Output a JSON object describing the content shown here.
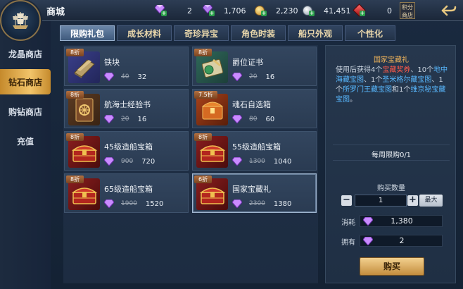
{
  "header": {
    "title": "商城",
    "jifen_label": "积分商店",
    "resources": [
      {
        "icon": "purple-gem-plus-icon",
        "value": "2"
      },
      {
        "icon": "purple-gem-stack-icon",
        "value": "1,706"
      },
      {
        "icon": "gold-coin-icon",
        "value": "2,230"
      },
      {
        "icon": "silver-coin-icon",
        "value": "41,451"
      },
      {
        "icon": "red-gem-icon",
        "value": "0"
      }
    ]
  },
  "sidebar": {
    "items": [
      {
        "label": "龙晶商店"
      },
      {
        "label": "钻石商店"
      },
      {
        "label": "购钻商店"
      },
      {
        "label": "充值"
      }
    ]
  },
  "tabs": [
    {
      "label": "限购礼包"
    },
    {
      "label": "成长材料"
    },
    {
      "label": "奇珍异宝"
    },
    {
      "label": "角色时装"
    },
    {
      "label": "船只外观"
    },
    {
      "label": "个性化"
    }
  ],
  "items": [
    {
      "badge": "8折",
      "name": "铁块",
      "old_price": "40",
      "price": "32",
      "icon": "iron-bar-icon"
    },
    {
      "badge": "8折",
      "name": "爵位证书",
      "old_price": "20",
      "price": "16",
      "icon": "certificate-icon"
    },
    {
      "badge": "8折",
      "name": "航海士经验书",
      "old_price": "20",
      "price": "16",
      "icon": "book-icon"
    },
    {
      "badge": "7.5折",
      "name": "魂石自选箱",
      "old_price": "80",
      "price": "60",
      "icon": "soulstone-box-icon"
    },
    {
      "badge": "8折",
      "name": "45级造船宝箱",
      "old_price": "900",
      "price": "720",
      "icon": "treasure-chest-icon"
    },
    {
      "badge": "8折",
      "name": "55级造船宝箱",
      "old_price": "1300",
      "price": "1040",
      "icon": "treasure-chest-icon"
    },
    {
      "badge": "8折",
      "name": "65级造船宝箱",
      "old_price": "1900",
      "price": "1520",
      "icon": "treasure-chest-icon"
    },
    {
      "badge": "6折",
      "name": "国家宝藏礼",
      "old_price": "2300",
      "price": "1380",
      "icon": "treasure-chest-icon"
    }
  ],
  "detail": {
    "title": "国家宝藏礼",
    "desc": {
      "p1": "使用后获得4个",
      "h1": "宝藏奖券",
      "p2": "、10个",
      "h2": "地中海藏宝图",
      "p3": "、1个",
      "h3": "圣米格尔藏宝图",
      "p4": "、1个",
      "h4": "所罗门王藏宝图",
      "p5": "和1个",
      "h5": "维京秘宝藏宝图",
      "p6": "。"
    },
    "weekly_limit": "每周限购0/1",
    "qty_label": "购买数量",
    "qty_value": "1",
    "minus": "−",
    "plus": "+",
    "max_label": "最大",
    "cost_label": "消耗",
    "cost_value": "1,380",
    "own_label": "拥有",
    "own_value": "2",
    "buy_label": "购买"
  },
  "colors": {
    "accent_gold": "#f2c46a",
    "highlight_red": "#ff5a4a",
    "highlight_blue": "#58b8ff",
    "title_orange": "#f0b45a"
  }
}
